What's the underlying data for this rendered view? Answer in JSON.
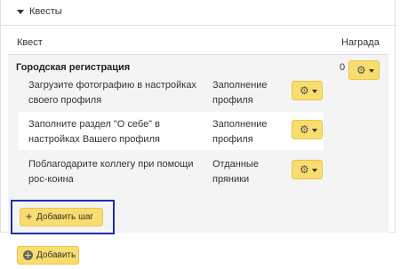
{
  "panel": {
    "title": "Квесты"
  },
  "table": {
    "col_quest": "Квест",
    "col_reward": "Награда"
  },
  "quest": {
    "title": "Городская регистрация",
    "reward": "0",
    "steps": [
      {
        "text": "Загрузите фотографию в настройках своего профиля",
        "type": "Заполнение профиля"
      },
      {
        "text": "Заполните раздел \"О себе\" в настройках Вашего профиля",
        "type": "Заполнение профиля"
      },
      {
        "text": "Поблагодарите коллегу при помощи рос-коина",
        "type": "Отданные пряники"
      }
    ]
  },
  "buttons": {
    "add_step": "Добавить шаг",
    "add": "Добавить"
  },
  "colors": {
    "button_yellow": "#f9dd6e",
    "highlight_border": "#1f2fa8",
    "row_bg": "#f4f4f4"
  },
  "icons": {
    "gear": "gear-icon",
    "caret": "caret-down-icon",
    "plus": "plus-icon",
    "plus_circle": "plus-circle-icon"
  }
}
